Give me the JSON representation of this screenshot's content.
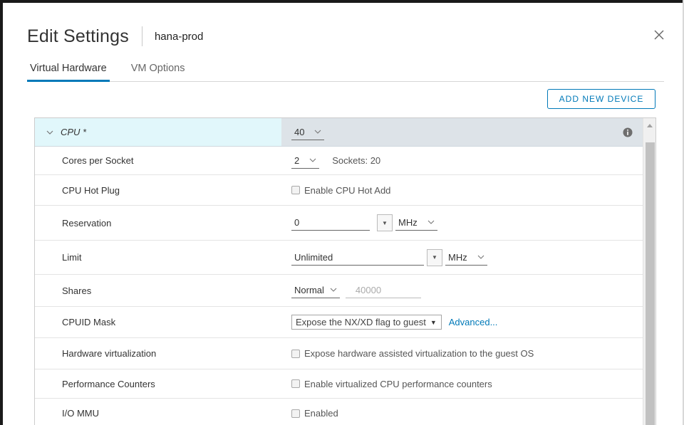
{
  "dialog": {
    "title": "Edit Settings",
    "vm_name": "hana-prod"
  },
  "tabs": [
    {
      "label": "Virtual Hardware",
      "active": true
    },
    {
      "label": "VM Options",
      "active": false
    }
  ],
  "toolbar": {
    "add_device_label": "ADD NEW DEVICE"
  },
  "cpu": {
    "section_label": "CPU *",
    "count": "40",
    "cores_per_socket": {
      "label": "Cores per Socket",
      "value": "2",
      "sockets_text": "Sockets: 20"
    },
    "hot_plug": {
      "label": "CPU Hot Plug",
      "checkbox_label": "Enable CPU Hot Add",
      "checked": false
    },
    "reservation": {
      "label": "Reservation",
      "value": "0",
      "unit": "MHz"
    },
    "limit": {
      "label": "Limit",
      "value": "Unlimited",
      "unit": "MHz"
    },
    "shares": {
      "label": "Shares",
      "level": "Normal",
      "value": "40000"
    },
    "cpuid_mask": {
      "label": "CPUID Mask",
      "value": "Expose the NX/XD flag to guest",
      "link": "Advanced..."
    },
    "hw_virtualization": {
      "label": "Hardware virtualization",
      "checkbox_label": "Expose hardware assisted virtualization to the guest OS",
      "checked": false
    },
    "perf_counters": {
      "label": "Performance Counters",
      "checkbox_label": "Enable virtualized CPU performance counters",
      "checked": false
    },
    "io_mmu": {
      "label": "I/O MMU",
      "checkbox_label": "Enabled",
      "checked": false
    }
  },
  "icons": {
    "close": "close-icon",
    "info": "info-icon",
    "expand": "chevron-down-icon"
  },
  "colors": {
    "accent": "#0079b8",
    "header_label_bg": "#e1f7fb",
    "header_value_bg": "#dde3e8"
  }
}
